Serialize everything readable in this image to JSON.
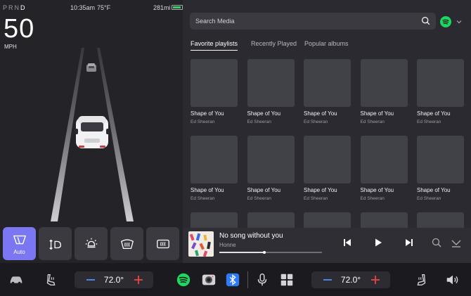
{
  "status": {
    "gears": [
      "P",
      "R",
      "N",
      "D"
    ],
    "active_gear": "D",
    "time": "10:35am",
    "outside_temp": "75°F",
    "range": "281mi"
  },
  "speed": {
    "value": "50",
    "unit": "MPH"
  },
  "quick_controls": [
    {
      "name": "wipers",
      "label": "Auto",
      "active": true
    },
    {
      "name": "headlights-adjust",
      "label": "",
      "active": false
    },
    {
      "name": "dome-light",
      "label": "",
      "active": false
    },
    {
      "name": "front-defrost",
      "label": "",
      "active": false
    },
    {
      "name": "rear-defrost",
      "label": "",
      "active": false
    }
  ],
  "media": {
    "search_placeholder": "Search Media",
    "source_icon": "spotify-icon",
    "tabs": [
      {
        "label": "Favorite playlists",
        "active": true
      },
      {
        "label": "Recently Played",
        "active": false
      },
      {
        "label": "Popular albums",
        "active": false
      }
    ],
    "cards": [
      {
        "title": "Shape of You",
        "artist": "Ed Sheeran"
      },
      {
        "title": "Shape of You",
        "artist": "Ed Sheeran"
      },
      {
        "title": "Shape of You",
        "artist": "Ed Sheeran"
      },
      {
        "title": "Shape of You",
        "artist": "Ed Sheeran"
      },
      {
        "title": "Shape of You",
        "artist": "Ed Sheeran"
      },
      {
        "title": "Shape of You",
        "artist": "Ed Sheeran"
      },
      {
        "title": "Shape of You",
        "artist": "Ed Sheeran"
      },
      {
        "title": "Shape of You",
        "artist": "Ed Sheeran"
      },
      {
        "title": "Shape of You",
        "artist": "Ed Sheeran"
      },
      {
        "title": "Shape of You",
        "artist": "Ed Sheeran"
      },
      {
        "title": "",
        "artist": ""
      },
      {
        "title": "",
        "artist": ""
      },
      {
        "title": "",
        "artist": ""
      },
      {
        "title": "",
        "artist": ""
      },
      {
        "title": "",
        "artist": ""
      }
    ]
  },
  "now_playing": {
    "title": "No song without you",
    "artist": "Honne",
    "progress": 0.44
  },
  "bottom_bar": {
    "driver_temp": "72.0°",
    "passenger_temp": "72.0°",
    "apps": [
      "spotify-icon",
      "camera-icon",
      "bluetooth-icon",
      "microphone-icon",
      "app-launcher-icon"
    ]
  },
  "colors": {
    "accent": "#7b76f2",
    "minus": "#4f8ef7",
    "plus": "#e84545",
    "spotify": "#1ed760",
    "bluetooth": "#2f7bf6",
    "battery": "#35d06a"
  }
}
